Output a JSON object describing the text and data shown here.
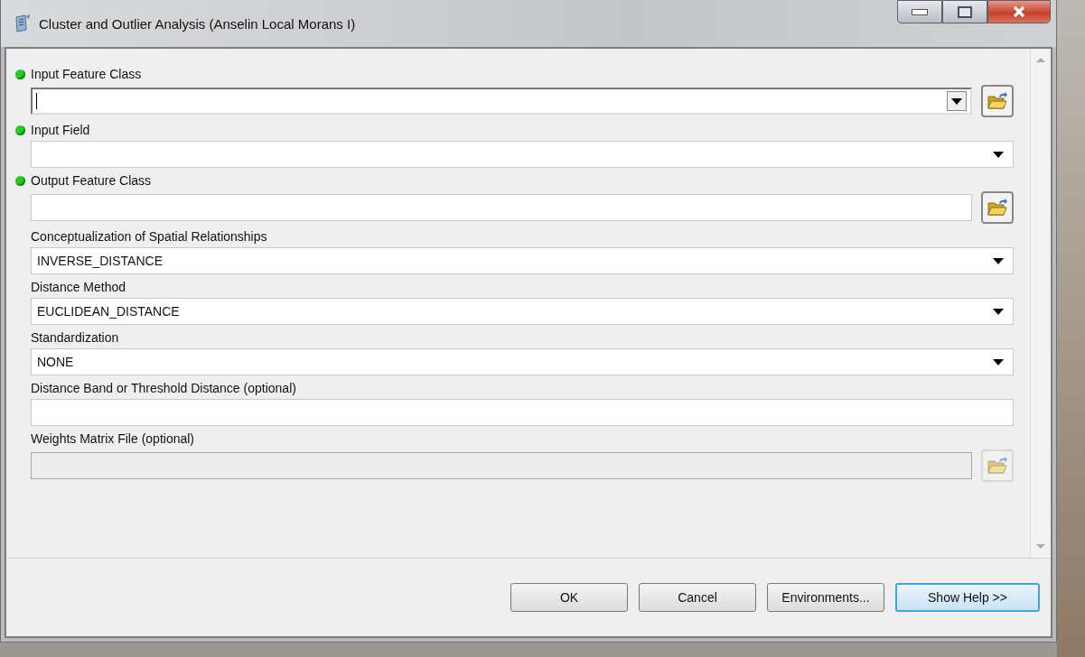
{
  "window": {
    "title": "Cluster and Outlier Analysis (Anselin Local Morans I)"
  },
  "parameters": [
    {
      "label": "Input Feature Class",
      "required": true,
      "kind": "combo",
      "browse": true,
      "disabled": false
    },
    {
      "label": "Input Field",
      "required": true,
      "kind": "dropdown",
      "browse": false,
      "disabled": false
    },
    {
      "label": "Output Feature Class",
      "required": true,
      "kind": "text",
      "browse": true,
      "disabled": false
    },
    {
      "label": "Conceptualization of Spatial Relationships",
      "required": false,
      "kind": "dropdown",
      "value": "INVERSE_DISTANCE",
      "browse": false,
      "disabled": false
    },
    {
      "label": "Distance Method",
      "required": false,
      "kind": "dropdown",
      "value": "EUCLIDEAN_DISTANCE",
      "browse": false,
      "disabled": false
    },
    {
      "label": "Standardization",
      "required": false,
      "kind": "dropdown",
      "value": "NONE",
      "browse": false,
      "disabled": false
    },
    {
      "label": "Distance Band or Threshold Distance (optional)",
      "required": false,
      "kind": "text",
      "browse": false,
      "disabled": false
    },
    {
      "label": "Weights Matrix File (optional)",
      "required": false,
      "kind": "text",
      "browse": true,
      "disabled": true
    }
  ],
  "buttons": [
    {
      "label": "OK",
      "focused": false
    },
    {
      "label": "Cancel",
      "focused": false
    },
    {
      "label": "Environments...",
      "focused": false
    },
    {
      "label": "Show Help >>",
      "focused": true
    }
  ]
}
